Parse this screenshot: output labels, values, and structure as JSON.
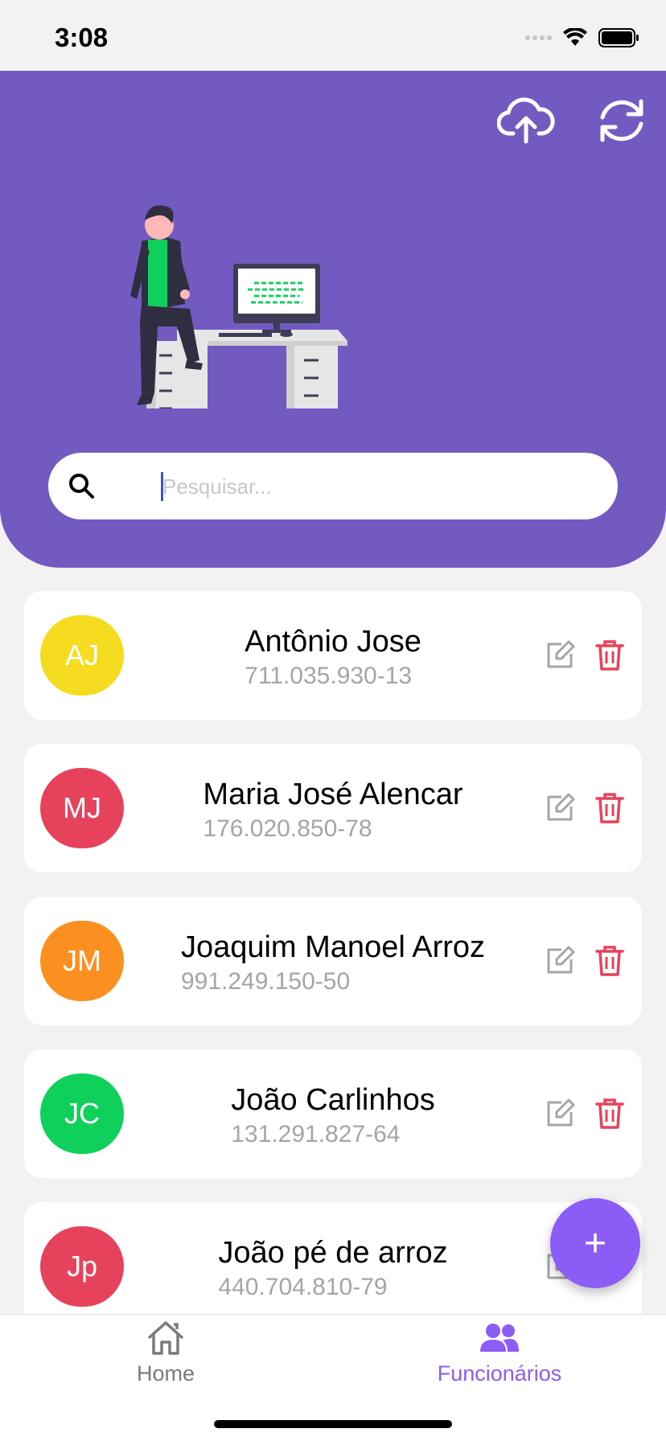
{
  "status_bar": {
    "time": "3:08"
  },
  "header": {
    "upload_icon": "cloud-upload-icon",
    "sync_icon": "sync-icon",
    "illustration": "developer-at-desk-illustration"
  },
  "search": {
    "placeholder": "Pesquisar..."
  },
  "employees": [
    {
      "initials": "AJ",
      "name": "Antônio Jose",
      "cpf": "711.035.930-13",
      "color": "#f5dc21"
    },
    {
      "initials": "MJ",
      "name": "Maria José Alencar",
      "cpf": "176.020.850-78",
      "color": "#e7425c"
    },
    {
      "initials": "JM",
      "name": "Joaquim Manoel Arroz",
      "cpf": "991.249.150-50",
      "color": "#fb9020"
    },
    {
      "initials": "JC",
      "name": "João Carlinhos",
      "cpf": "131.291.827-64",
      "color": "#10d05c"
    },
    {
      "initials": "Jp",
      "name": "João pé de arroz",
      "cpf": "440.704.810-79",
      "color": "#e7425c"
    }
  ],
  "fab": {
    "label": "+"
  },
  "tabs": [
    {
      "label": "Home",
      "icon": "home-icon",
      "active": false
    },
    {
      "label": "Funcionários",
      "icon": "users-icon",
      "active": true
    }
  ],
  "colors": {
    "primary": "#725ac1",
    "accent": "#8c5cf6",
    "danger": "#e7425c",
    "muted": "#a5a5a5"
  }
}
